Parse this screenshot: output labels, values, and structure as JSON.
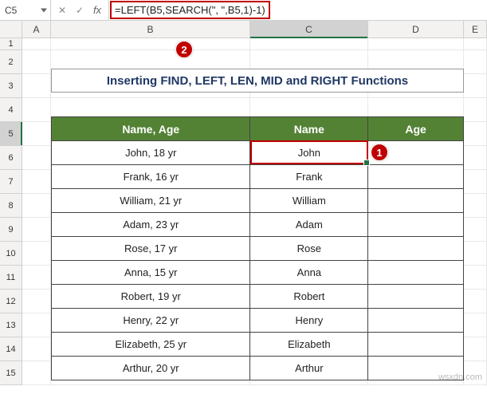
{
  "name_box": "C5",
  "formula": "=LEFT(B5,SEARCH(\", \",B5,1)-1)",
  "columns": {
    "A": "A",
    "B": "B",
    "C": "C",
    "D": "D",
    "E": "E"
  },
  "rows": [
    "1",
    "2",
    "3",
    "4",
    "5",
    "6",
    "7",
    "8",
    "9",
    "10",
    "11",
    "12",
    "13",
    "14",
    "15"
  ],
  "title": "Inserting FIND, LEFT, LEN, MID and RIGHT Functions",
  "headers": {
    "b": "Name, Age",
    "c": "Name",
    "d": "Age"
  },
  "data": [
    {
      "b": "John, 18 yr",
      "c": "John",
      "d": ""
    },
    {
      "b": "Frank, 16 yr",
      "c": "Frank",
      "d": ""
    },
    {
      "b": "William, 21 yr",
      "c": "William",
      "d": ""
    },
    {
      "b": "Adam, 23 yr",
      "c": "Adam",
      "d": ""
    },
    {
      "b": "Rose, 17 yr",
      "c": "Rose",
      "d": ""
    },
    {
      "b": "Anna, 15 yr",
      "c": "Anna",
      "d": ""
    },
    {
      "b": "Robert, 19 yr",
      "c": "Robert",
      "d": ""
    },
    {
      "b": "Henry, 22 yr",
      "c": "Henry",
      "d": ""
    },
    {
      "b": "Elizabeth, 25 yr",
      "c": "Elizabeth",
      "d": ""
    },
    {
      "b": "Arthur, 20 yr",
      "c": "Arthur",
      "d": ""
    }
  ],
  "callouts": {
    "one": "1",
    "two": "2"
  },
  "watermark": "wsxdn.com"
}
